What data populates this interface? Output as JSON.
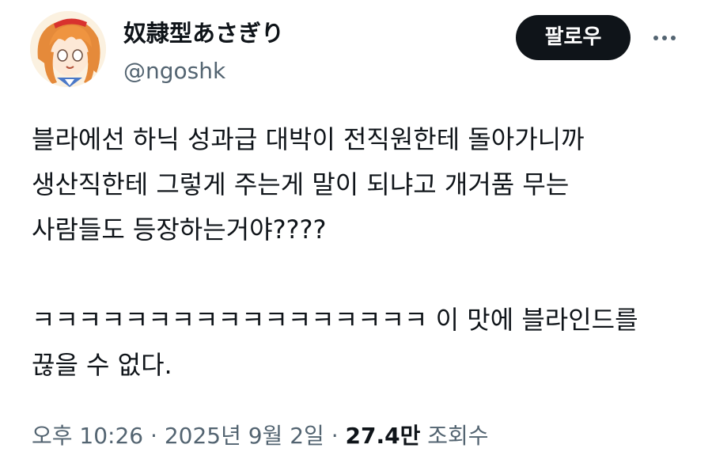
{
  "user": {
    "display_name": "奴隷型あさぎり",
    "handle": "@ngoshk",
    "avatar_icon": "anime-girl-avatar-icon"
  },
  "actions": {
    "follow_label": "팔로우",
    "more_icon": "more-dots-icon"
  },
  "tweet": {
    "lines": [
      "블라에선 하닉 성과급 대박이 전직원한테 돌아가니까",
      "생산직한테 그렇게 주는게 말이 되냐고 개거품 무는",
      "사람들도 등장하는거야????",
      "",
      "ㅋㅋㅋㅋㅋㅋㅋㅋㅋㅋㅋㅋㅋㅋㅋㅋㅋ 이 맛에 블라인드를",
      "끊을 수 없다."
    ]
  },
  "meta": {
    "time": "오후 10:26",
    "separator_1": " · ",
    "date": "2025년 9월 2일",
    "separator_2": " · ",
    "views_count": "27.4만",
    "views_label": " 조회수"
  },
  "colors": {
    "text_primary": "#0f1419",
    "text_secondary": "#536471",
    "follow_bg": "#0f1419",
    "follow_text": "#ffffff"
  }
}
